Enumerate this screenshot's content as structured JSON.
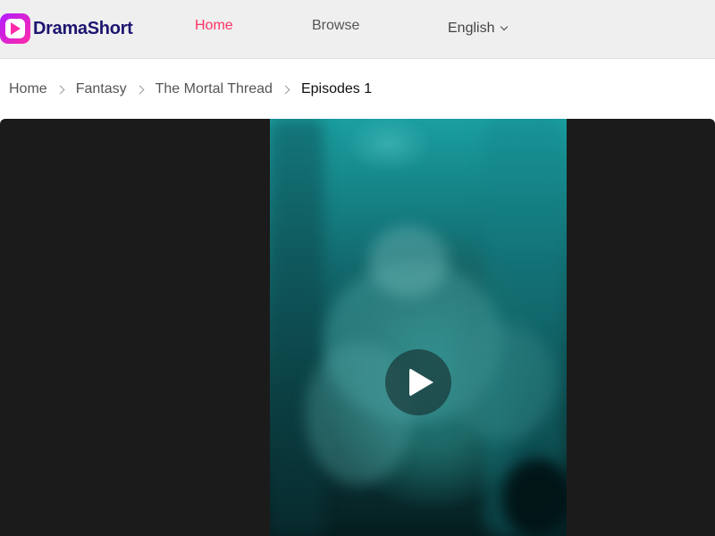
{
  "brand": {
    "name": "DramaShort",
    "accent": "#ff3366"
  },
  "nav": {
    "home_label": "Home",
    "browse_label": "Browse",
    "language_label": "English"
  },
  "breadcrumb": {
    "items": [
      "Home",
      "Fantasy",
      "The Mortal Thread",
      "Episodes 1"
    ]
  },
  "player": {
    "play_icon": "play-icon"
  }
}
